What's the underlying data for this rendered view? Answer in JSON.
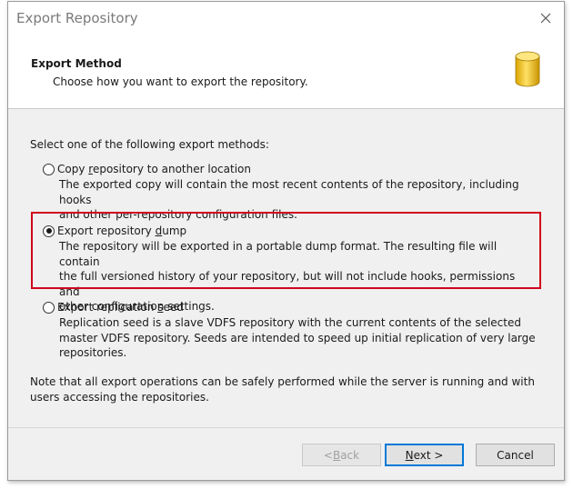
{
  "window": {
    "title": "Export Repository",
    "close_icon": "close-icon"
  },
  "header": {
    "title": "Export Method",
    "subtitle": "Choose how you want to export the repository.",
    "icon": "database-icon",
    "icon_color": "#f2c200"
  },
  "intro": "Select one of the following export methods:",
  "options": [
    {
      "label_pre": "Copy ",
      "label_key": "r",
      "label_post": "epository to another location",
      "description": "The exported copy will contain the most recent contents of the repository, including hooks\nand other per-repository configuration files.",
      "selected": false
    },
    {
      "label_pre": "Export repository ",
      "label_key": "d",
      "label_post": "ump",
      "description": "The repository will be exported in a portable dump format. The resulting file will contain\nthe full versioned history of your repository, but will not include hooks, permissions and\nother configuration settings.",
      "selected": true
    },
    {
      "label_pre": "Export replication ",
      "label_key": "s",
      "label_post": "eed",
      "description": "Replication seed is a slave VDFS repository with the current contents of the selected\nmaster VDFS repository. Seeds are intended to speed up initial replication of very large\nrepositories.",
      "selected": false
    }
  ],
  "note": "Note that all export operations can be safely performed while the server is running and with\nusers accessing the repositories.",
  "buttons": {
    "back_pre": "< ",
    "back_key": "B",
    "back_post": "ack",
    "next_key": "N",
    "next_post": "ext >",
    "cancel": "Cancel"
  },
  "highlight_color": "#d0021b"
}
